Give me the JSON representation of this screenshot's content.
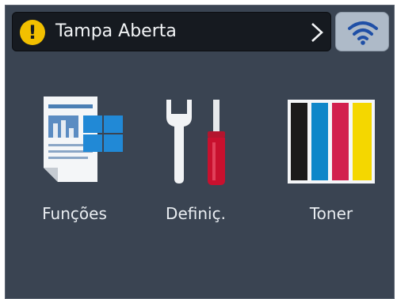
{
  "status_bar": {
    "message": "Tampa Aberta",
    "warning_symbol": "!",
    "warning_icon": "exclamation-warning-icon",
    "arrow_icon": "chevron-right-icon"
  },
  "wifi_button": {
    "icon": "wifi-icon"
  },
  "tiles": [
    {
      "label": "Funções",
      "icon": "functions-document-icon"
    },
    {
      "label": "Definiç.",
      "icon": "wrench-screwdriver-icon"
    },
    {
      "label": "Toner",
      "icon": "toner-cartridges-icon"
    }
  ],
  "colors": {
    "background": "#3a4452",
    "status_bar": "#161a20",
    "warning": "#f2c000",
    "wifi_button": "#aebac8",
    "wifi_accent": "#1f4fa6",
    "toner_black": "#1b1b1b",
    "toner_cyan": "#0e87c9",
    "toner_magenta": "#d2204e",
    "toner_yellow": "#f4d700"
  }
}
